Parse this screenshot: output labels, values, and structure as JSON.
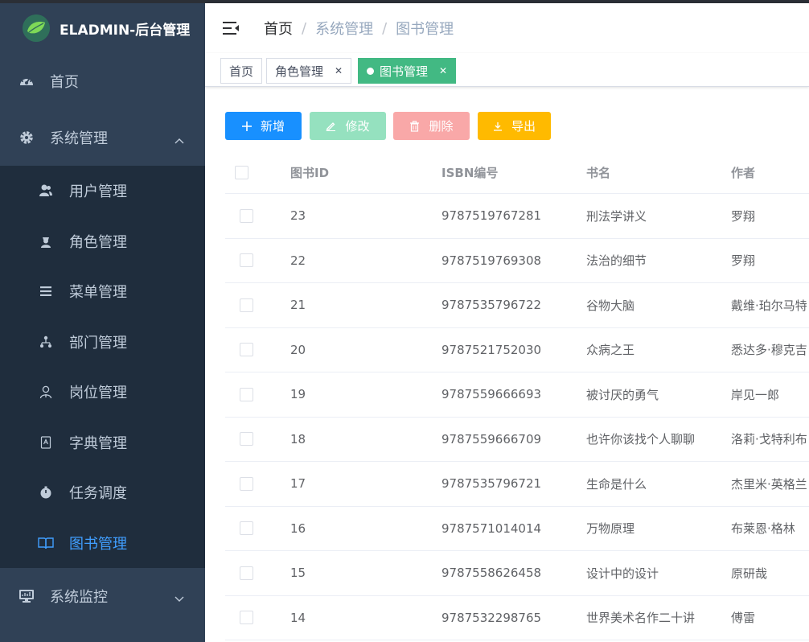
{
  "app": {
    "title": "ELADMIN-后台管理"
  },
  "sidebar": {
    "top_items": [
      {
        "label": "首页",
        "icon": "dashboard-icon"
      },
      {
        "label": "系统管理",
        "icon": "gear-icon",
        "expanded": true
      }
    ],
    "sub_items": [
      {
        "label": "用户管理",
        "icon": "users-icon"
      },
      {
        "label": "角色管理",
        "icon": "role-icon"
      },
      {
        "label": "菜单管理",
        "icon": "menu-list-icon"
      },
      {
        "label": "部门管理",
        "icon": "org-tree-icon"
      },
      {
        "label": "岗位管理",
        "icon": "job-icon"
      },
      {
        "label": "字典管理",
        "icon": "dictionary-icon"
      },
      {
        "label": "任务调度",
        "icon": "timer-icon"
      },
      {
        "label": "图书管理",
        "icon": "book-icon",
        "active": true
      }
    ],
    "bottom_items": [
      {
        "label": "系统监控",
        "icon": "monitor-icon"
      }
    ]
  },
  "breadcrumb": {
    "items": [
      "首页",
      "系统管理",
      "图书管理"
    ]
  },
  "tags": [
    {
      "label": "首页"
    },
    {
      "label": "角色管理"
    },
    {
      "label": "图书管理",
      "active": true
    }
  ],
  "toolbar": {
    "add_label": "新增",
    "edit_label": "修改",
    "delete_label": "删除",
    "export_label": "导出"
  },
  "table": {
    "columns": [
      "图书ID",
      "ISBN编号",
      "书名",
      "作者"
    ],
    "rows": [
      {
        "id": "23",
        "isbn": "9787519767281",
        "name": "刑法学讲义",
        "author": "罗翔"
      },
      {
        "id": "22",
        "isbn": "9787519769308",
        "name": "法治的细节",
        "author": "罗翔"
      },
      {
        "id": "21",
        "isbn": "9787535796722",
        "name": "谷物大脑",
        "author": "戴维·珀尔马特"
      },
      {
        "id": "20",
        "isbn": "9787521752030",
        "name": "众病之王",
        "author": "悉达多·穆克吉"
      },
      {
        "id": "19",
        "isbn": "9787559666693",
        "name": "被讨厌的勇气",
        "author": "岸见一郎"
      },
      {
        "id": "18",
        "isbn": "9787559666709",
        "name": "也许你该找个人聊聊",
        "author": "洛莉·戈特利布"
      },
      {
        "id": "17",
        "isbn": "9787535796721",
        "name": "生命是什么",
        "author": "杰里米·英格兰"
      },
      {
        "id": "16",
        "isbn": "9787571014014",
        "name": "万物原理",
        "author": "布莱恩·格林"
      },
      {
        "id": "15",
        "isbn": "9787558626458",
        "name": "设计中的设计",
        "author": "原研哉"
      },
      {
        "id": "14",
        "isbn": "9787532298765",
        "name": "世界美术名作二十讲",
        "author": "傅雷"
      }
    ]
  },
  "colors": {
    "sidebar_bg": "#304156",
    "submenu_bg": "#1f2d3d",
    "active": "#409eff",
    "tag_active": "#42b983",
    "primary": "#1890ff",
    "success_light": "#95e1bf",
    "danger_light": "#f9a8a8",
    "warning": "#ffba00"
  }
}
